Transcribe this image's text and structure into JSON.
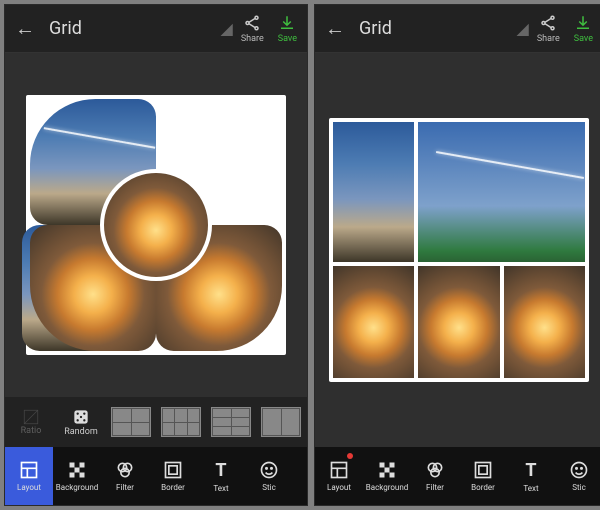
{
  "header": {
    "title": "Grid",
    "share_label": "Share",
    "save_label": "Save"
  },
  "layout_row": {
    "ratio_label": "Ratio",
    "random_label": "Random"
  },
  "tools": {
    "layout": "Layout",
    "background": "Background",
    "filter": "Filter",
    "border": "Border",
    "text": "Text",
    "sticker": "Stic"
  }
}
